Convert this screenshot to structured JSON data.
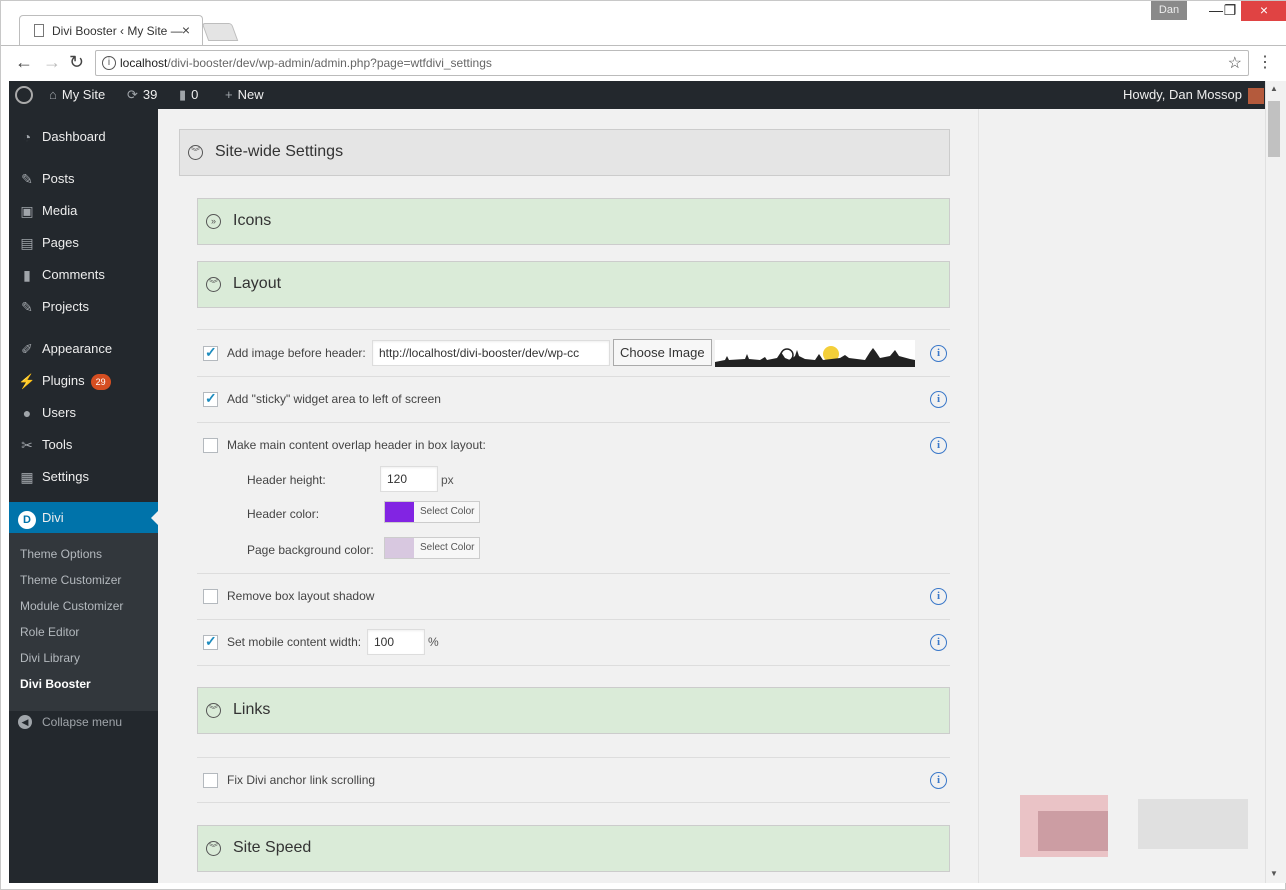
{
  "browser": {
    "tab_title": "Divi Booster ‹ My Site —",
    "tab_close": "×",
    "user_chip": "Dan",
    "url_host": "localhost",
    "url_path": "/divi-booster/dev/wp-admin/admin.php?page=wtfdivi_settings",
    "win_min": "—",
    "win_max": "❐",
    "win_close": "×"
  },
  "adminbar": {
    "site_name": "My Site",
    "updates_count": "39",
    "comments_count": "0",
    "new_label": "New",
    "greeting": "Howdy, Dan Mossop"
  },
  "sidebar": {
    "items": [
      {
        "label": "Dashboard",
        "icon": "dashboard-icon"
      },
      {
        "label": "Posts",
        "icon": "pin-icon"
      },
      {
        "label": "Media",
        "icon": "media-icon"
      },
      {
        "label": "Pages",
        "icon": "pages-icon"
      },
      {
        "label": "Comments",
        "icon": "comment-icon"
      },
      {
        "label": "Projects",
        "icon": "pin-icon"
      },
      {
        "label": "Appearance",
        "icon": "brush-icon"
      },
      {
        "label": "Plugins",
        "icon": "plugin-icon",
        "badge": "29"
      },
      {
        "label": "Users",
        "icon": "user-icon"
      },
      {
        "label": "Tools",
        "icon": "wrench-icon"
      },
      {
        "label": "Settings",
        "icon": "settings-icon"
      },
      {
        "label": "Divi",
        "icon": "divi-icon"
      }
    ],
    "submenu": [
      "Theme Options",
      "Theme Customizer",
      "Module Customizer",
      "Role Editor",
      "Divi Library",
      "Divi Booster"
    ],
    "collapse_label": "Collapse menu"
  },
  "sections": {
    "site_wide": "Site-wide Settings",
    "icons": "Icons",
    "layout": "Layout",
    "links": "Links",
    "site_speed": "Site Speed"
  },
  "layout_options": {
    "image_before_header": {
      "label": "Add image before header:",
      "checked": true,
      "value": "http://localhost/divi-booster/dev/wp-cc",
      "button": "Choose Image"
    },
    "sticky_widget": {
      "label": "Add \"sticky\" widget area to left of screen",
      "checked": true
    },
    "overlap_header": {
      "label": "Make main content overlap header in box layout:",
      "checked": false,
      "header_height_label": "Header height:",
      "header_height_value": "120",
      "header_height_unit": "px",
      "header_color_label": "Header color:",
      "header_color": "#8224e3",
      "page_bg_label": "Page background color:",
      "page_bg_color": "#d8c8e0",
      "select_color": "Select Color"
    },
    "remove_shadow": {
      "label": "Remove box layout shadow",
      "checked": false
    },
    "mobile_width": {
      "label": "Set mobile content width:",
      "checked": true,
      "value": "100",
      "unit": "%"
    }
  },
  "links_options": {
    "anchor_scrolling": {
      "label": "Fix Divi anchor link scrolling",
      "checked": false
    }
  },
  "colors": {
    "admin_bar": "#23282d",
    "active_menu": "#0073aa",
    "section_green": "#daebd8",
    "info_blue": "#3a78c9"
  }
}
